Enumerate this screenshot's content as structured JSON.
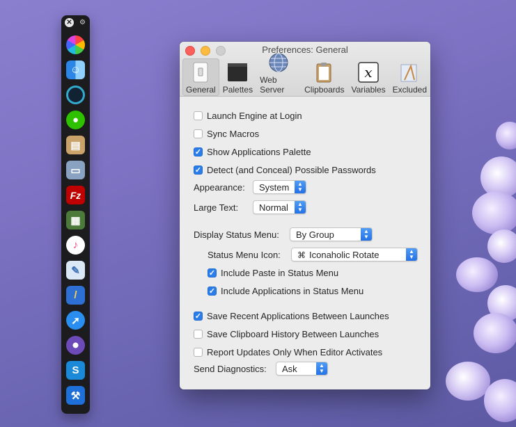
{
  "window": {
    "title": "Preferences: General",
    "toolbar": [
      {
        "label": "General",
        "icon": "general-icon"
      },
      {
        "label": "Palettes",
        "icon": "palettes-icon"
      },
      {
        "label": "Web Server",
        "icon": "web-server-icon"
      },
      {
        "label": "Clipboards",
        "icon": "clipboards-icon"
      },
      {
        "label": "Variables",
        "icon": "variables-icon"
      },
      {
        "label": "Excluded",
        "icon": "excluded-icon"
      }
    ],
    "selected_tab": "General"
  },
  "settings": {
    "launch_engine": {
      "label": "Launch Engine at Login",
      "checked": false
    },
    "sync_macros": {
      "label": "Sync Macros",
      "checked": false
    },
    "show_apps_palette": {
      "label": "Show Applications Palette",
      "checked": true
    },
    "detect_passwords": {
      "label": "Detect (and Conceal) Possible Passwords",
      "checked": true
    },
    "appearance": {
      "label": "Appearance:",
      "value": "System"
    },
    "large_text": {
      "label": "Large Text:",
      "value": "Normal"
    },
    "display_status_menu": {
      "label": "Display Status Menu:",
      "value": "By Group"
    },
    "status_menu_icon": {
      "label": "Status Menu Icon:",
      "value": "Iconaholic Rotate",
      "glyph": "⌘"
    },
    "include_paste": {
      "label": "Include Paste in Status Menu",
      "checked": true
    },
    "include_apps": {
      "label": "Include Applications in Status Menu",
      "checked": true
    },
    "save_recent_apps": {
      "label": "Save Recent Applications Between Launches",
      "checked": true
    },
    "save_clipboard": {
      "label": "Save Clipboard History Between Launches",
      "checked": false
    },
    "report_updates": {
      "label": "Report Updates Only When Editor Activates",
      "checked": false
    },
    "send_diagnostics": {
      "label": "Send Diagnostics:",
      "value": "Ask"
    }
  },
  "palette": {
    "icons": [
      "color-wheel-icon",
      "finder-icon",
      "quicktime-icon",
      "wechat-icon",
      "archive-icon",
      "scanner-icon",
      "filezilla-icon",
      "calculator-icon",
      "itunes-icon",
      "preview-icon",
      "xcode-doc-icon",
      "safari-icon",
      "photo-booth-icon",
      "shazam-icon",
      "xcode-icon"
    ]
  }
}
